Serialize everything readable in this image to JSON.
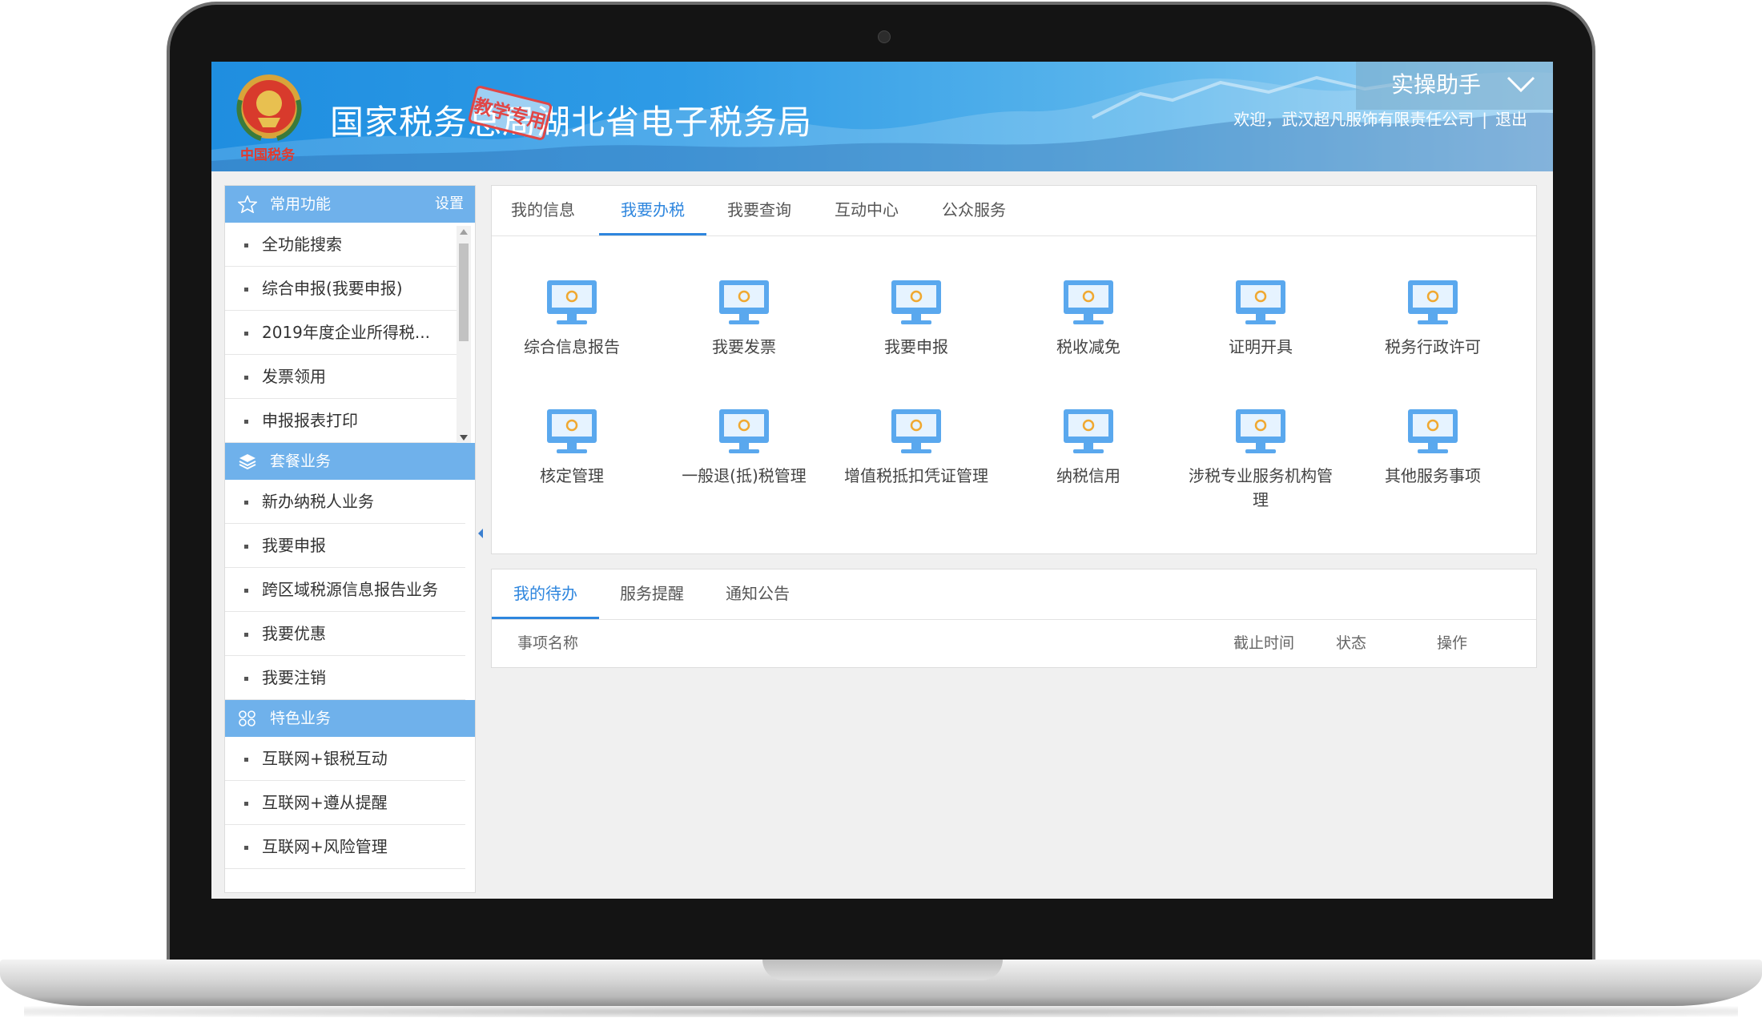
{
  "header": {
    "site_title": "国家税务总局湖北省电子税务局",
    "stamp": "教学专用",
    "emblem_caption": "中国税务",
    "assistant_label": "实操助手",
    "welcome_text": "欢迎，武汉超凡服饰有限责任公司",
    "separator": "|",
    "logout": "退出"
  },
  "sidebar": {
    "common": {
      "title": "常用功能",
      "setting": "设置",
      "icon": "star-icon",
      "items": [
        "全功能搜索",
        "综合申报(我要申报)",
        "2019年度企业所得税...",
        "发票领用",
        "申报报表打印"
      ]
    },
    "package": {
      "title": "套餐业务",
      "icon": "layers-icon",
      "items": [
        "新办纳税人业务",
        "我要申报",
        "跨区域税源信息报告业务",
        "我要优惠",
        "我要注销"
      ]
    },
    "special": {
      "title": "特色业务",
      "icon": "grid-icon",
      "items": [
        "互联网+银税互动",
        "互联网+遵从提醒",
        "互联网+风险管理"
      ]
    }
  },
  "main_tabs": [
    "我的信息",
    "我要办税",
    "我要查询",
    "互动中心",
    "公众服务"
  ],
  "active_main_tab": "我要办税",
  "services": [
    {
      "label": "综合信息报告",
      "icon": "monitor-icon"
    },
    {
      "label": "我要发票",
      "icon": "monitor-icon"
    },
    {
      "label": "我要申报",
      "icon": "monitor-icon"
    },
    {
      "label": "税收减免",
      "icon": "monitor-icon"
    },
    {
      "label": "证明开具",
      "icon": "monitor-icon"
    },
    {
      "label": "税务行政许可",
      "icon": "monitor-icon"
    },
    {
      "label": "核定管理",
      "icon": "monitor-icon"
    },
    {
      "label": "一般退(抵)税管理",
      "icon": "monitor-icon"
    },
    {
      "label": "增值税抵扣凭证管理",
      "icon": "monitor-icon"
    },
    {
      "label": "纳税信用",
      "icon": "monitor-icon"
    },
    {
      "label": "涉税专业服务机构管理",
      "icon": "monitor-icon"
    },
    {
      "label": "其他服务事项",
      "icon": "monitor-icon"
    }
  ],
  "todo": {
    "tabs": [
      "我的待办",
      "服务提醒",
      "通知公告"
    ],
    "active_tab": "我的待办",
    "columns": {
      "name": "事项名称",
      "deadline": "截止时间",
      "status": "状态",
      "action": "操作"
    }
  },
  "colors": {
    "accent": "#2e86de",
    "sidebar_header": "#6fb1eb",
    "banner": "#2e9be6"
  }
}
